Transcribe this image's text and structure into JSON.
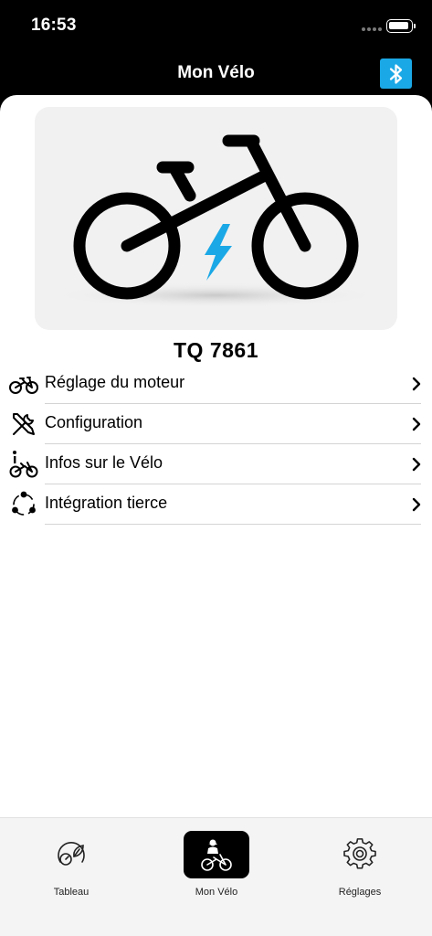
{
  "status_bar": {
    "time": "16:53"
  },
  "nav": {
    "title": "Mon Vélo",
    "bluetooth_icon": "bluetooth-icon"
  },
  "bike": {
    "name": "TQ 7861",
    "image_icon": "ebike-illustration"
  },
  "menu": {
    "items": [
      {
        "label": "Réglage du moteur",
        "icon": "bike-motor-icon"
      },
      {
        "label": "Configuration",
        "icon": "tools-icon"
      },
      {
        "label": "Infos sur le Vélo",
        "icon": "bike-info-icon"
      },
      {
        "label": "Intégration tierce",
        "icon": "integration-icon"
      }
    ]
  },
  "tabs": [
    {
      "label": "Tableau",
      "icon": "dashboard-icon",
      "active": false
    },
    {
      "label": "Mon Vélo",
      "icon": "rider-bike-icon",
      "active": true
    },
    {
      "label": "Réglages",
      "icon": "gear-icon",
      "active": false
    }
  ],
  "colors": {
    "accent": "#1ba8e6",
    "header_bg": "#000000",
    "tab_bar_bg": "#f4f4f4"
  }
}
